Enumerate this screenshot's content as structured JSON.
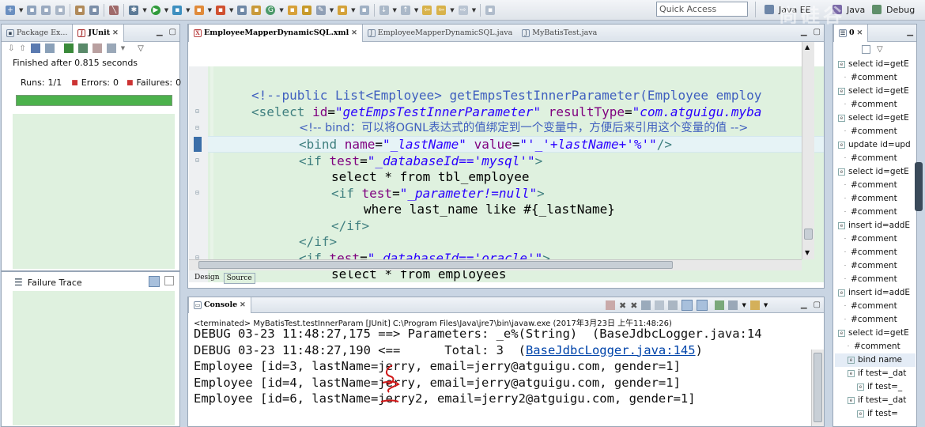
{
  "toolbar": {
    "quick_access": "Quick Access",
    "perspectives": [
      "Java EE",
      "Java",
      "Debug"
    ]
  },
  "left_panel": {
    "tabs": [
      "Package Ex...",
      "JUnit"
    ],
    "status": "Finished after 0.815 seconds",
    "runs_label": "Runs:",
    "runs_value": "1/1",
    "errors_label": "Errors:",
    "errors_value": "0",
    "failures_label": "Failures:",
    "failures_value": "0",
    "progress": 1.0,
    "progress_color": "#4cb14c",
    "failure_trace_label": "Failure Trace"
  },
  "editor": {
    "tabs": [
      "EmployeeMapperDynamicSQL.xml",
      "EmployeeMapperDynamicSQL.java",
      "MyBatisTest.java"
    ],
    "bottom_tabs": [
      "Design",
      "Source"
    ],
    "lines": [
      "<!--public List<Employee> getEmpsTestInnerParameter(Employee employ",
      "<select id=\"getEmpsTestInnerParameter\" resultType=\"com.atguigu.myba",
      "<!-- bind：可以将OGNL表达式的值绑定到一个变量中，方便后来引用这个变量的值 -->",
      "<bind name=\"_lastName\" value=\"'_'+lastName+'%'\"/>",
      "<if test=\"_databaseId=='mysql'\">",
      "select * from tbl_employee",
      "<if test=\"_parameter!=null\">",
      "where last_name like #{_lastName}",
      "</if>",
      "</if>",
      "<if test=\"_databaseId=='oracle'\">",
      "select * from employees"
    ]
  },
  "console": {
    "tab_label": "Console",
    "header": "<terminated> MyBatisTest.testInnerParam [JUnit] C:\\Program Files\\Java\\jre7\\bin\\javaw.exe (2017年3月23日 上午11:48:26)",
    "lines": [
      "DEBUG 03-23 11:48:27,175 ==> Parameters: _e%(String)  (BaseJdbcLogger.java:14",
      "DEBUG 03-23 11:48:27,190 <==      Total: 3  ",
      "Employee [id=3, lastName=jerry, email=jerry@atguigu.com, gender=1]",
      "Employee [id=4, lastName=jerry, email=jerry@atguigu.com, gender=1]",
      "Employee [id=6, lastName=jerry2, email=jerry2@atguigu.com, gender=1]"
    ],
    "link_text": "BaseJdbcLogger.java:145",
    "link_suffix": ")"
  },
  "outline": {
    "tab_label": "0",
    "items": [
      "select id=getE",
      "#comment",
      "select id=getE",
      "#comment",
      "select id=getE",
      "#comment",
      "update id=upd",
      "#comment",
      "select id=getE",
      "#comment",
      "#comment",
      "#comment",
      "insert id=addE",
      "#comment",
      "#comment",
      "#comment",
      "#comment",
      "insert id=addE",
      "#comment",
      "#comment",
      "select id=getE",
      "#comment",
      "bind name",
      "if test=_dat",
      "if test=_",
      "if test=_dat",
      "if test="
    ]
  },
  "watermark": "尚硅谷"
}
